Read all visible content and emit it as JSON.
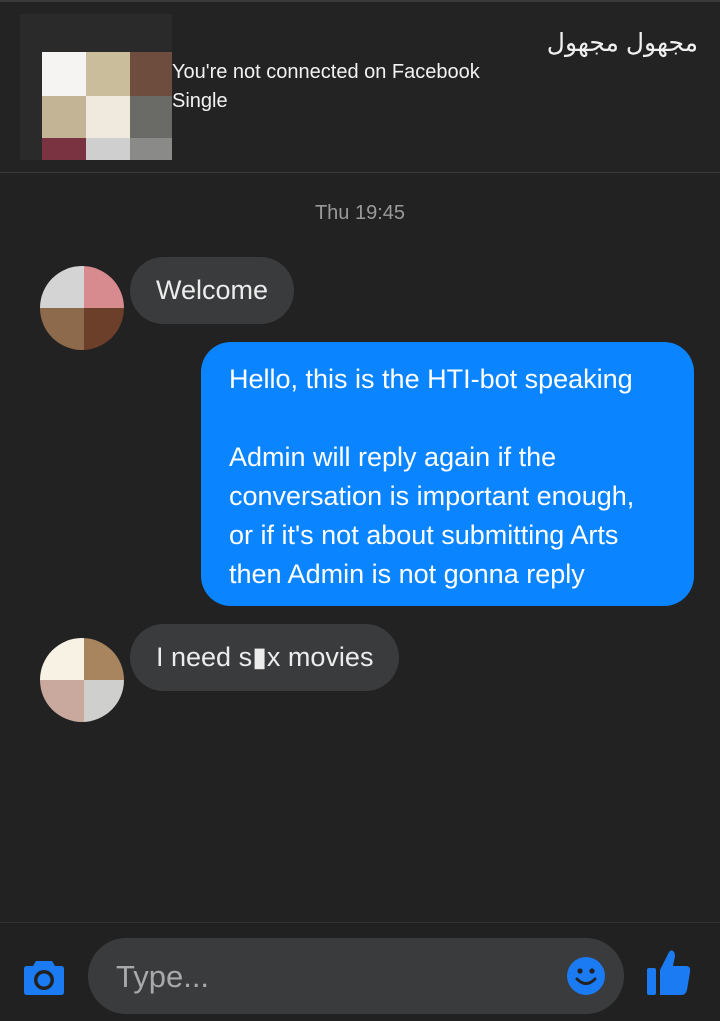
{
  "header": {
    "contact_name": "مجهول مجهول",
    "status_line_1": "You're not connected on Facebook",
    "status_line_2": "Single"
  },
  "conversation": {
    "timestamp": "Thu 19:45",
    "messages": [
      {
        "direction": "incoming",
        "text": "Welcome"
      },
      {
        "direction": "outgoing",
        "text": "Hello, this is the HTI-bot speaking\n\nAdmin will reply again if the\nconversation is important enough,\nor if it's not about submitting Arts\nthen Admin is not gonna reply"
      },
      {
        "direction": "incoming",
        "text": "I need s▮x movies"
      }
    ]
  },
  "composer": {
    "placeholder": "Type...",
    "camera_icon": "camera-icon",
    "emoji_icon": "smiley-icon",
    "like_icon": "thumbs-up-icon"
  },
  "colors": {
    "background": "#222222",
    "incoming_bubble": "#3a3b3c",
    "outgoing_bubble": "#0b84ff",
    "accent": "#1b7bf2"
  }
}
